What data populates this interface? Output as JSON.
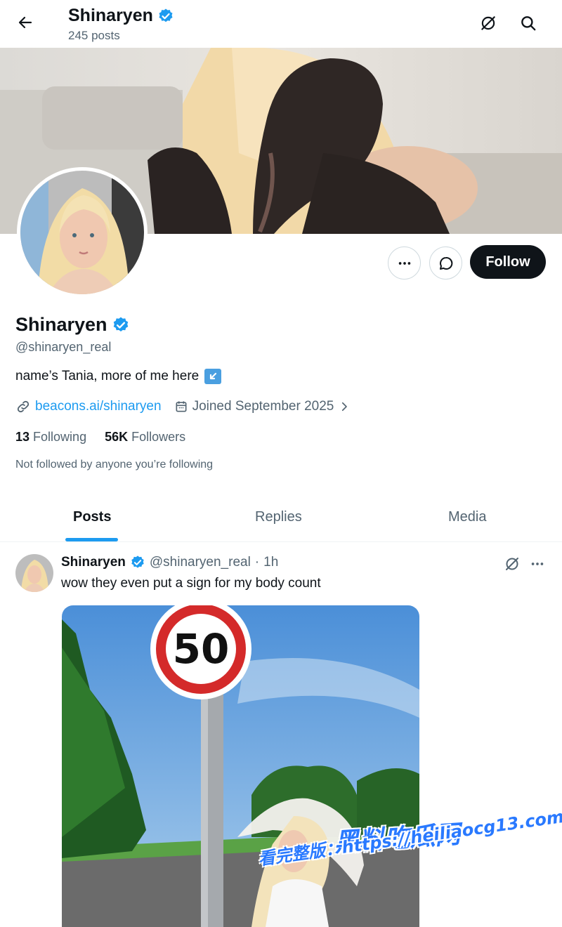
{
  "header": {
    "name": "Shinaryen",
    "posts_count": "245 posts"
  },
  "profile": {
    "name": "Shinaryen",
    "handle": "@shinaryen_real",
    "bio": "name’s Tania, more of me here",
    "link": "beacons.ai/shinaryen",
    "joined": "Joined September 2025",
    "following_count": "13",
    "following_label": "Following",
    "followers_count": "56K",
    "followers_label": "Followers",
    "not_followed": "Not followed by anyone you’re following",
    "follow_label": "Follow"
  },
  "tabs": [
    {
      "label": "Posts",
      "active": true
    },
    {
      "label": "Replies",
      "active": false
    },
    {
      "label": "Media",
      "active": false
    }
  ],
  "post": {
    "name": "Shinaryen",
    "handle": "@shinaryen_real",
    "separator": "·",
    "time": "1h",
    "text": "wow they even put a sign for my body count",
    "sign_value": "50"
  },
  "watermark": {
    "line1": "黑料吃瓜网",
    "line2": "看完整版：https://heiliaocg13.com"
  },
  "colors": {
    "accent": "#1d9bf0",
    "follow_button": "#0f1419",
    "secondary_text": "#536471"
  }
}
